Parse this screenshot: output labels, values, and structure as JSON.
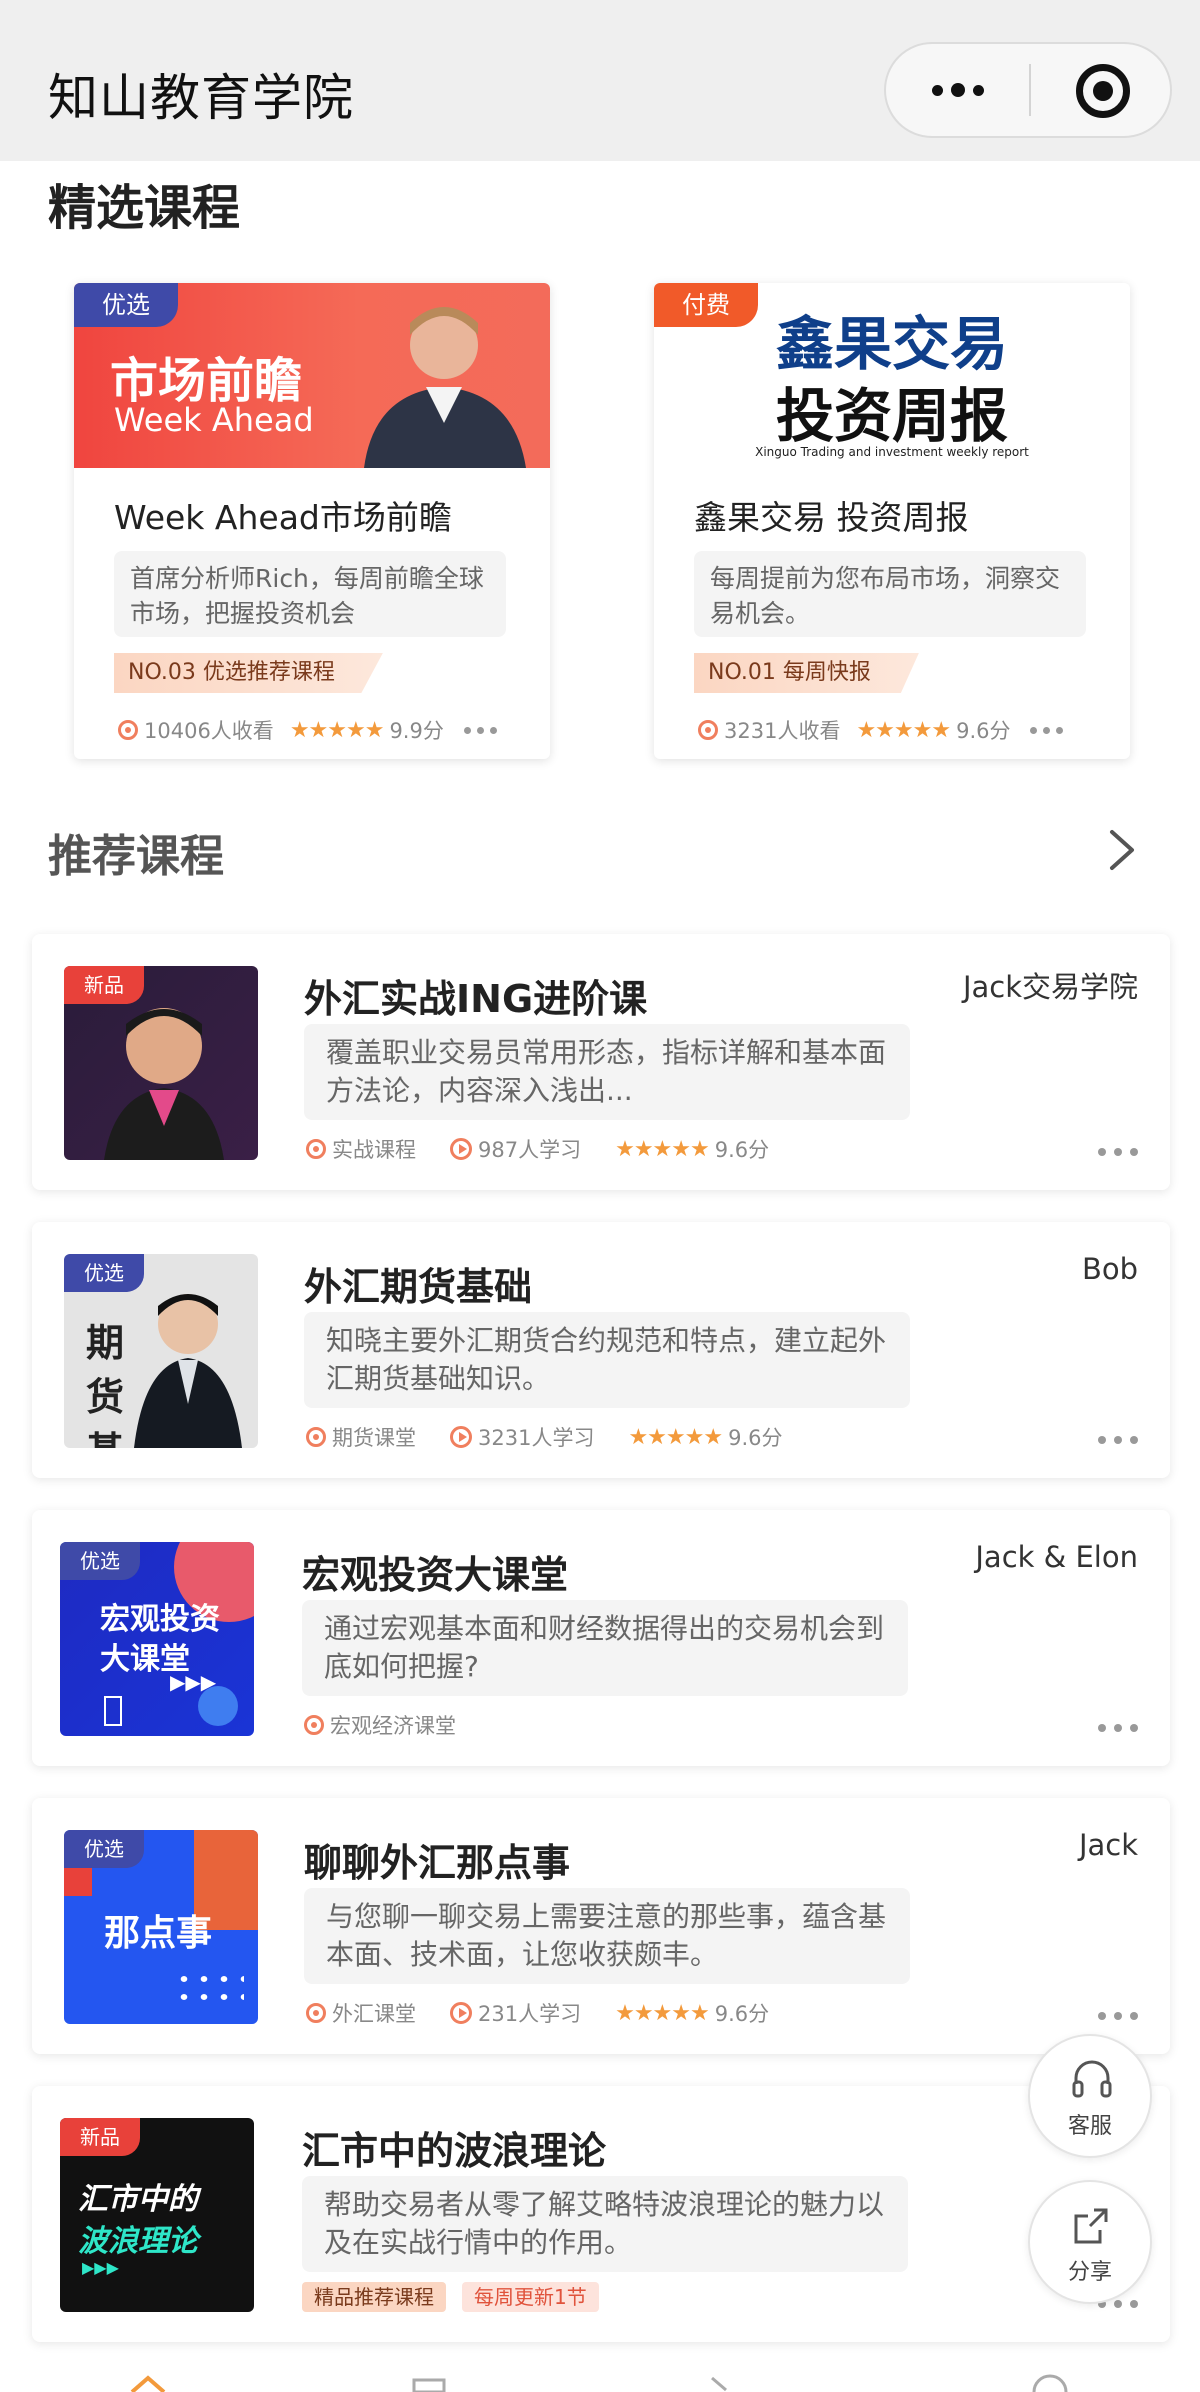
{
  "header": {
    "title": "知山教育学院"
  },
  "featured": {
    "title": "精选课程",
    "cards": [
      {
        "tag": "优选",
        "tag_color": "#3f4aa8",
        "banner_line1": "市场前瞻",
        "banner_line2": "Week Ahead",
        "title": "Week Ahead市场前瞻",
        "desc": "首席分析师Rich，每周前瞻全球市场，把握投资机会",
        "badge": "NO.03 优选推荐课程",
        "views": "10406人收看",
        "stars": "★★★★★",
        "score": "9.9分"
      },
      {
        "tag": "付费",
        "tag_color": "#f15a29",
        "banner_line1": "鑫果交易",
        "banner_line2": "投资周报",
        "banner_sub": "Xinguo Trading and investment weekly report",
        "title": "鑫果交易 投资周报",
        "desc": "每周提前为您布局市场，洞察交易机会。",
        "badge": "NO.01 每周快报",
        "views": "3231人收看",
        "stars": "★★★★★",
        "score": "9.6分"
      }
    ]
  },
  "recommend": {
    "title": "推荐课程",
    "items": [
      {
        "tag": "新品",
        "tag_color": "#e8413a",
        "title": "外汇实战ING进阶课",
        "author": "Jack交易学院",
        "desc": "覆盖职业交易员常用形态，指标详解和基本面方法论，内容深入浅出...",
        "category": "实战课程",
        "learners": "987人学习",
        "stars": "★★★★★",
        "score": "9.6分"
      },
      {
        "tag": "优选",
        "tag_color": "#3f4aa8",
        "thumb_text": "期货 基础",
        "title": "外汇期货基础",
        "author": "Bob",
        "desc": "知晓主要外汇期货合约规范和特点，建立起外汇期货基础知识。",
        "category": "期货课堂",
        "learners": "3231人学习",
        "stars": "★★★★★",
        "score": "9.6分"
      },
      {
        "tag": "优选",
        "tag_color": "#3f4aa8",
        "thumb_line1": "宏观投资",
        "thumb_line2": "大课堂",
        "title": "宏观投资大课堂",
        "author": "Jack & Elon",
        "desc": "通过宏观基本面和财经数据得出的交易机会到底如何把握?",
        "category": "宏观经济课堂"
      },
      {
        "tag": "优选",
        "tag_color": "#3f4aa8",
        "thumb_text": "那点事",
        "title": "聊聊外汇那点事",
        "author": "Jack",
        "desc": "与您聊一聊交易上需要注意的那些事，蕴含基本面、技术面，让您收获颇丰。",
        "category": "外汇课堂",
        "learners": "231人学习",
        "stars": "★★★★★",
        "score": "9.6分"
      },
      {
        "tag": "新品",
        "tag_color": "#e8413a",
        "thumb_line1": "汇市中的",
        "thumb_line2": "波浪理论",
        "title": "汇市中的波浪理论",
        "desc": "帮助交易者从零了解艾略特波浪理论的魅力以及在实战行情中的作用。",
        "pill1": "精品推荐课程",
        "pill2": "每周更新1节"
      }
    ]
  },
  "fabs": {
    "service": "客服",
    "share": "分享"
  }
}
